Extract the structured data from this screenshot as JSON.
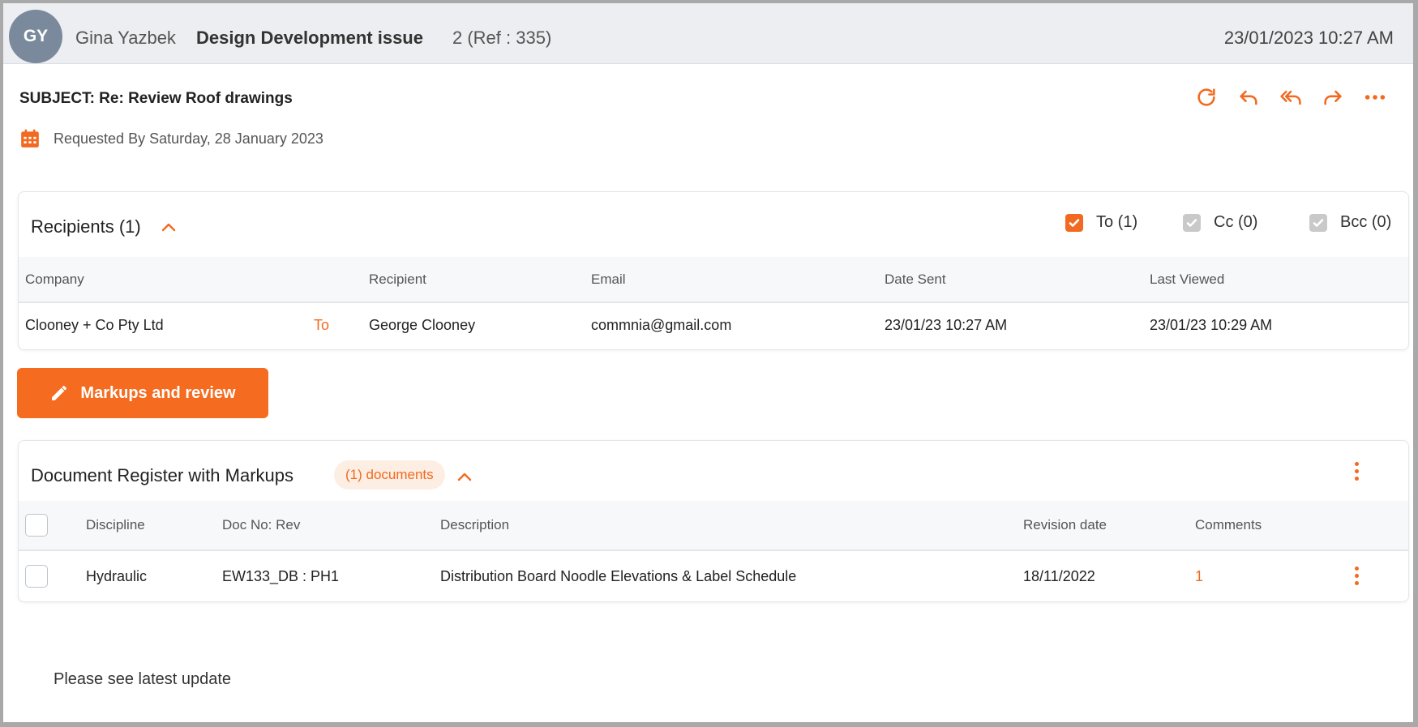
{
  "header": {
    "avatar_initials": "GY",
    "sender": "Gina Yazbek",
    "title": "Design Development issue",
    "ref": "2 (Ref : 335)",
    "datetime": "23/01/2023 10:27 AM"
  },
  "subject": "SUBJECT: Re: Review Roof drawings",
  "requested_by": "Requested By Saturday, 28 January 2023",
  "actions": [
    "refresh-icon",
    "reply-icon",
    "reply-all-icon",
    "forward-icon",
    "more-icon"
  ],
  "recipients": {
    "title": "Recipients (1)",
    "filters": [
      {
        "label": "To (1)",
        "checked": true
      },
      {
        "label": "Cc (0)",
        "checked": true
      },
      {
        "label": "Bcc (0)",
        "checked": true
      }
    ],
    "columns": [
      "Company",
      "Recipient",
      "Email",
      "Date Sent",
      "Last Viewed"
    ],
    "rows": [
      {
        "company": "Clooney + Co Pty Ltd",
        "type": "To",
        "recipient": "George Clooney",
        "email": "commnia@gmail.com",
        "date_sent": "23/01/23 10:27 AM",
        "last_viewed": "23/01/23 10:29 AM"
      }
    ]
  },
  "markup_button": "Markups and review",
  "documents": {
    "title": "Document Register with Markups",
    "count_badge": "(1) documents",
    "columns": [
      "Discipline",
      "Doc No: Rev",
      "Description",
      "Revision date",
      "Comments"
    ],
    "rows": [
      {
        "discipline": "Hydraulic",
        "doc_no": "EW133_DB : PH1",
        "description": "Distribution Board Noodle Elevations & Label Schedule",
        "revision_date": "18/11/2022",
        "comments": "1"
      }
    ]
  },
  "message_body": "Please see latest update",
  "colors": {
    "accent": "#f26a21",
    "avatar": "#7a8a9c",
    "header_bg": "#eceef1"
  }
}
